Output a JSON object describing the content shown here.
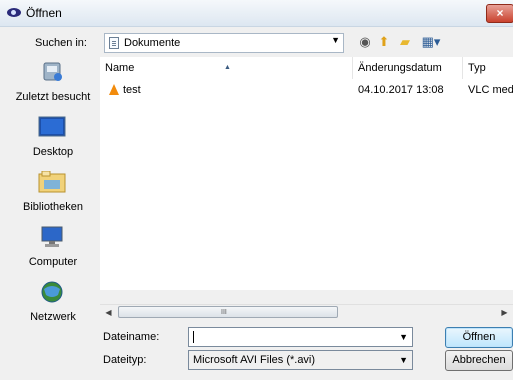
{
  "window": {
    "title": "Öffnen",
    "close_glyph": "×",
    "app_icon": "vlc-eye-icon"
  },
  "lookin": {
    "label": "Suchen in:",
    "value": "Dokumente",
    "value_icon": "document-folder-icon"
  },
  "toolbar": {
    "icons": [
      "back-icon",
      "up-folder-icon",
      "new-folder-icon",
      "view-menu-icon"
    ]
  },
  "places": [
    {
      "label": "Zuletzt besucht",
      "icon": "recent-places-icon"
    },
    {
      "label": "Desktop",
      "icon": "desktop-icon"
    },
    {
      "label": "Bibliotheken",
      "icon": "libraries-icon"
    },
    {
      "label": "Computer",
      "icon": "computer-icon"
    },
    {
      "label": "Netzwerk",
      "icon": "network-icon"
    }
  ],
  "filelist": {
    "columns": [
      "Name",
      "Änderungsdatum",
      "Typ"
    ],
    "rows": [
      {
        "name": "test",
        "date": "04.10.2017 13:08",
        "type": "VLC media",
        "icon": "vlc-cone-icon"
      }
    ]
  },
  "scrollbar": {
    "grip": "III"
  },
  "filename": {
    "label": "Dateiname:",
    "value": ""
  },
  "filetype": {
    "label": "Dateityp:",
    "value": "Microsoft AVI Files (*.avi)"
  },
  "buttons": {
    "open": "Öffnen",
    "cancel": "Abbrechen"
  },
  "colors": {
    "close_button": "#c9422e",
    "vlc_orange": "#f28b0c",
    "primary_button": "#bee6fd"
  }
}
